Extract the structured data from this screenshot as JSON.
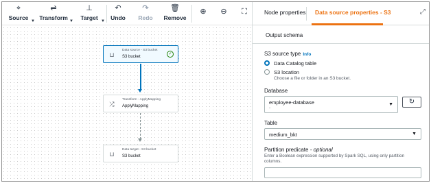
{
  "toolbar": {
    "buttons": [
      {
        "label": "Source",
        "icon": "source-icon",
        "glyph": "⌖",
        "dropdown": true,
        "enabled": true
      },
      {
        "label": "Transform",
        "icon": "transform-icon",
        "glyph": "⇌",
        "dropdown": true,
        "enabled": true
      },
      {
        "label": "Target",
        "icon": "target-icon",
        "glyph": "⊥",
        "dropdown": true,
        "enabled": true
      },
      {
        "label": "Undo",
        "icon": "undo-icon",
        "glyph": "↶",
        "dropdown": false,
        "enabled": true
      },
      {
        "label": "Redo",
        "icon": "redo-icon",
        "glyph": "↷",
        "dropdown": false,
        "enabled": false
      },
      {
        "label": "Remove",
        "icon": "trash-icon",
        "glyph": "🗑",
        "dropdown": false,
        "enabled": true
      }
    ],
    "zoom_in_glyph": "⊕",
    "zoom_out_glyph": "⊖",
    "fit_glyph": "⛶"
  },
  "canvas": {
    "nodes": [
      {
        "subtitle": "Data source - S3 bucket",
        "title": "S3 bucket",
        "icon": "bucket-icon",
        "glyph": "⊔",
        "selected": true,
        "status": "check-icon"
      },
      {
        "subtitle": "Transform - ApplyMapping",
        "title": "ApplyMapping",
        "icon": "shuffle-icon",
        "glyph": "⤮",
        "selected": false
      },
      {
        "subtitle": "Data target - S3 bucket",
        "title": "S3 bucket",
        "icon": "bucket-icon",
        "glyph": "⊔",
        "selected": false
      }
    ]
  },
  "panel": {
    "tabs": [
      {
        "label": "Node properties",
        "active": false
      },
      {
        "label": "Data source properties - S3",
        "active": true
      }
    ],
    "subtab": "Output schema",
    "source_type": {
      "label": "S3 source type",
      "info": "Info",
      "options": [
        {
          "label": "Data Catalog table",
          "checked": true,
          "description": ""
        },
        {
          "label": "S3 location",
          "checked": false,
          "description": "Choose a file or folder in an S3 bucket."
        }
      ]
    },
    "database": {
      "label": "Database",
      "value": "employee-database",
      "sub": "-"
    },
    "table": {
      "label": "Table",
      "value": "medium_bkt"
    },
    "partition": {
      "label": "Partition predicate",
      "optional": "- optional",
      "description": "Enter a Boolean expression supported by Spark SQL, using only partition columns.",
      "value": ""
    }
  },
  "colors": {
    "accent": "#ec7211",
    "link": "#0073bb",
    "success": "#1d8102"
  }
}
